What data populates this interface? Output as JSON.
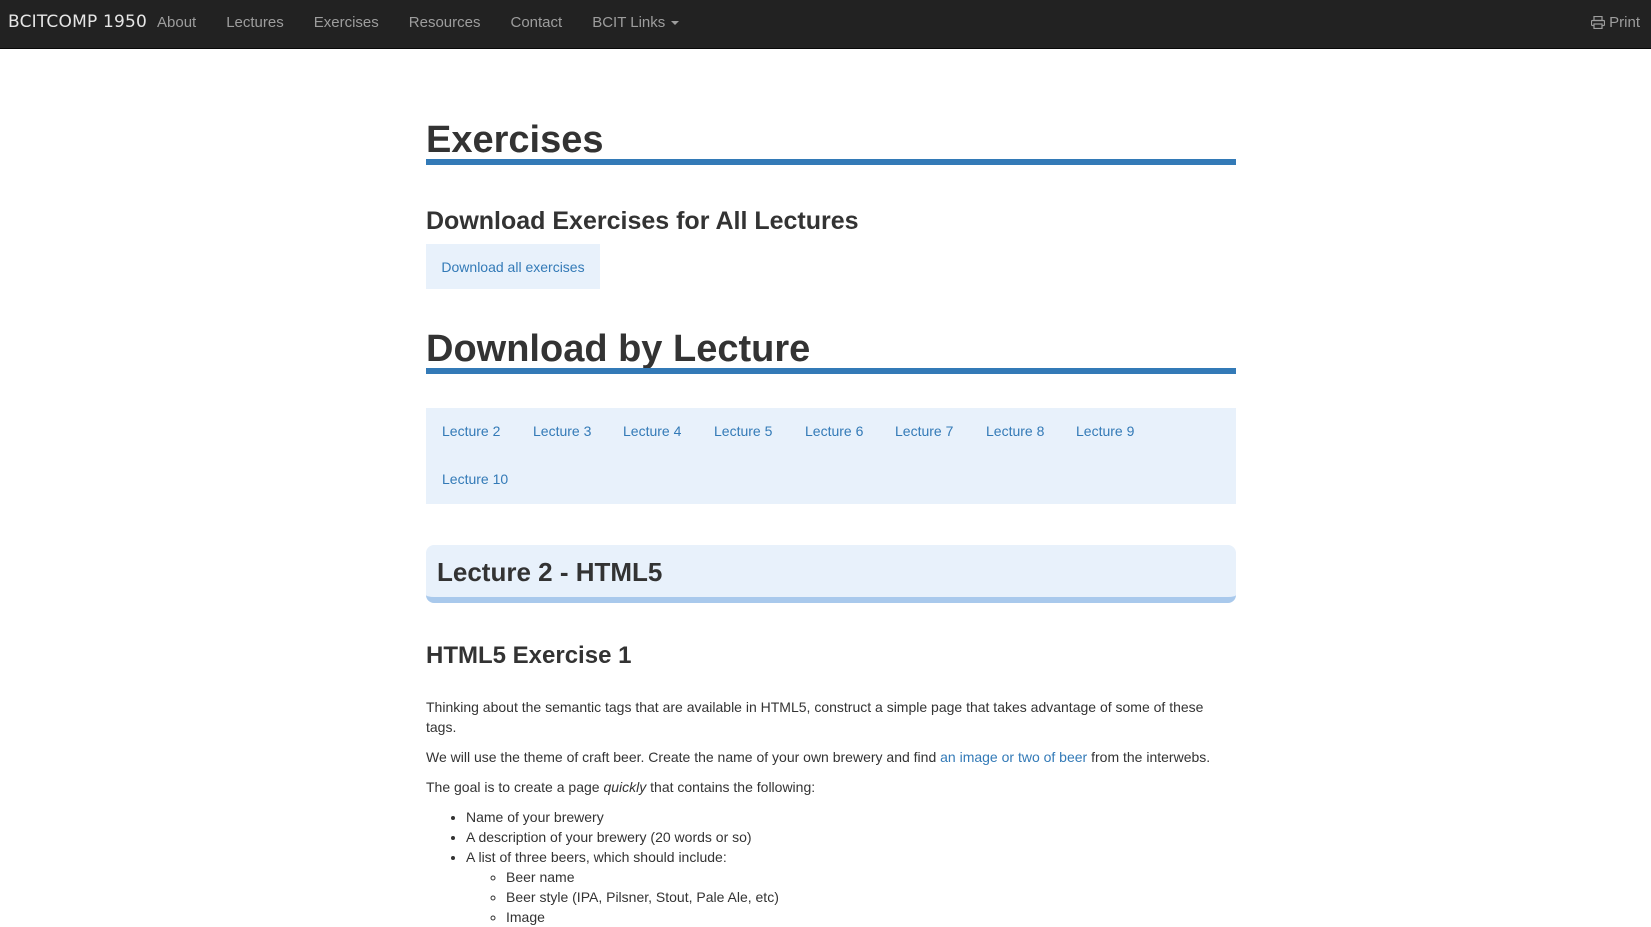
{
  "nav": {
    "brand": "BCITCOMP 1950",
    "links": [
      "About",
      "Lectures",
      "Exercises",
      "Resources",
      "Contact",
      "BCIT Links"
    ],
    "print": "Print"
  },
  "main": {
    "title": "Exercises",
    "download_all_heading": "Download Exercises for All Lectures",
    "download_all_link": "Download all exercises",
    "by_lecture_title": "Download by Lecture",
    "lectures": [
      "Lecture 2",
      "Lecture 3",
      "Lecture 4",
      "Lecture 5",
      "Lecture 6",
      "Lecture 7",
      "Lecture 8",
      "Lecture 9",
      "Lecture 10"
    ],
    "section_title": "Lecture 2 - HTML5",
    "exercise_title": "HTML5 Exercise 1",
    "para1": "Thinking about the semantic tags that are available in HTML5, construct a simple page that takes advantage of some of these tags.",
    "para2_before": "We will use the theme of craft beer. Create the name of your own brewery and find ",
    "para2_link": "an image or two of beer",
    "para2_after": " from the interwebs.",
    "para3_before": "The goal is to create a page ",
    "para3_em": "quickly",
    "para3_after": " that contains the following:",
    "list": [
      "Name of your brewery",
      "A description of your brewery (20 words or so)",
      "A list of three beers, which should include:"
    ],
    "sublist": [
      "Beer name",
      "Beer style (IPA, Pilsner, Stout, Pale Ale, etc)",
      "Image"
    ]
  },
  "colors": {
    "navbar": "#222222",
    "accent": "#337ab7",
    "panel": "#e8f1fb"
  }
}
